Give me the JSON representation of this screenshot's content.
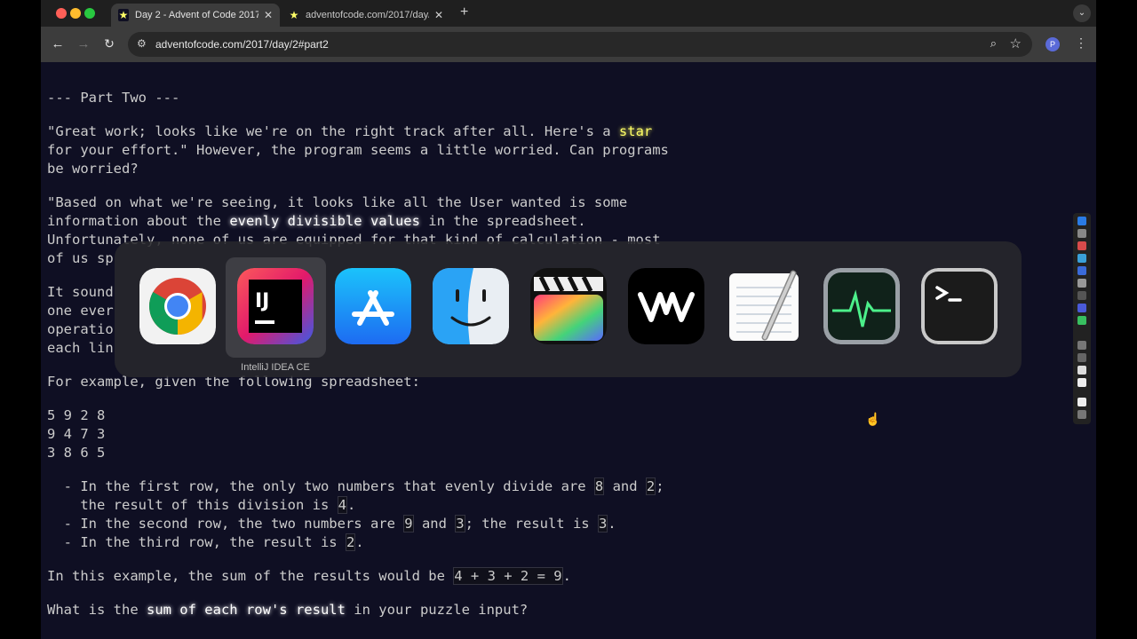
{
  "browser": {
    "tabs": [
      {
        "title": "Day 2 - Advent of Code 2017",
        "favicon": "star-icon",
        "active": true
      },
      {
        "title": "adventofcode.com/2017/day/",
        "favicon": "star-icon",
        "active": false
      }
    ],
    "url": "adventofcode.com/2017/day/2#part2",
    "profile_initial": "P"
  },
  "content": {
    "heading": "--- Part Two ---",
    "p1_a": "\"Great work; looks like we're on the right track after all. Here's a ",
    "p1_star": "star",
    "p1_b": "for your effort.\" However, the program seems a little worried. Can programs",
    "p1_c": "be worried?",
    "p2_a": "\"Based on what we're seeing, it looks like all the User wanted is some",
    "p2_b1": "information about the ",
    "p2_b2": "evenly divisible values",
    "p2_b3": " in the spreadsheet.",
    "p2_c": "Unfortunately, none of us are equipped for that kind of calculation - most",
    "p2_d": "of us sp",
    "p3_a": "It sound",
    "p3_b": "one ever",
    "p3_c": "operatio",
    "p3_d": "each lin",
    "p4": "For example, given the following spreadsheet:",
    "rows": [
      "5 9 2 8",
      "9 4 7 3",
      "3 8 6 5"
    ],
    "li1_a": "  - In the first row, the only two numbers that evenly divide are ",
    "li1_n1": "8",
    "li1_mid": " and ",
    "li1_n2": "2",
    "li1_end": ";",
    "li1_b": "    the result of this division is ",
    "li1_n3": "4",
    "li1_b_end": ".",
    "li2_a": "  - In the second row, the two numbers are ",
    "li2_n1": "9",
    "li2_mid": " and ",
    "li2_n2": "3",
    "li2_b": "; the result is ",
    "li2_n3": "3",
    "li2_end": ".",
    "li3_a": "  - In the third row, the result is ",
    "li3_n": "2",
    "li3_end": ".",
    "p5_a": "In this example, the sum of the results would be ",
    "p5_code": "4 + 3 + 2 = 9",
    "p5_end": ".",
    "p6_a": "What is the ",
    "p6_hl": "sum of each row's result",
    "p6_b": " in your puzzle input?"
  },
  "switcher": {
    "apps": [
      {
        "name": "chrome-icon"
      },
      {
        "name": "intellij-icon"
      },
      {
        "name": "app-store-icon"
      },
      {
        "name": "finder-icon"
      },
      {
        "name": "final-cut-icon"
      },
      {
        "name": "waves-icon"
      },
      {
        "name": "textedit-icon"
      },
      {
        "name": "activity-monitor-icon"
      },
      {
        "name": "terminal-icon"
      }
    ],
    "selected_label": "IntelliJ IDEA CE"
  }
}
